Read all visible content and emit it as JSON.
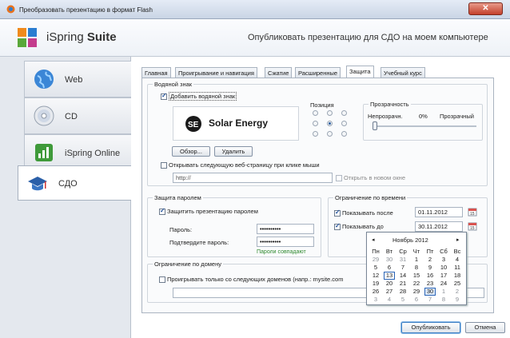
{
  "window": {
    "title": "Преобразовать презентацию в формат Flash",
    "close_icon": "close-icon"
  },
  "header": {
    "brand_name": "iSpring",
    "brand_product": "Suite",
    "subtitle": "Опубликовать презентацию для СДО на моем компьютере"
  },
  "sidebar": {
    "items": [
      {
        "label": "Web",
        "icon": "globe-icon"
      },
      {
        "label": "CD",
        "icon": "cd-icon"
      },
      {
        "label": "iSpring Online",
        "icon": "chart-icon"
      },
      {
        "label": "СДО",
        "icon": "graduation-cap-icon"
      }
    ]
  },
  "tabs": [
    "Главная",
    "Проигрывание и навигация",
    "Сжатие",
    "Расширенные",
    "Защита",
    "Учебный курс"
  ],
  "active_tab": "Защита",
  "watermark": {
    "group_label": "Водяной знак",
    "add_label": "Добавить водяной знак",
    "add_checked": true,
    "logo_mark": "SE",
    "logo_text": "Solar Energy",
    "position_label": "Позиция",
    "transparency_label": "Прозрачность",
    "opaque_label": "Непрозрачн.",
    "value_label": "0%",
    "transparent_label": "Прозрачный",
    "transparency_value": 0,
    "browse_button": "Обзор...",
    "delete_button": "Удалить",
    "open_page_label": "Открывать следующую веб-страницу при клике мыши",
    "open_page_checked": false,
    "url_value": "http://",
    "new_window_label": "Открыть в новом окне"
  },
  "password": {
    "group_label": "Защита паролем",
    "protect_label": "Защитить презентацию паролем",
    "protect_checked": true,
    "password_label": "Пароль:",
    "password_value": "••••••••••",
    "confirm_label": "Подтвердите пароль:",
    "confirm_value": "••••••••••",
    "match_text": "Пароли совпадают"
  },
  "time_limit": {
    "group_label": "Ограничение по времени",
    "show_after_label": "Показывать после",
    "show_after_value": "01.11.2012",
    "show_until_label": "Показывать до",
    "show_until_value": "30.11.2012"
  },
  "calendar": {
    "month": "Ноябрь 2012",
    "prev": "◂",
    "next": "▸",
    "weekdays": [
      "Пн",
      "Вт",
      "Ср",
      "Чт",
      "Пт",
      "Сб",
      "Вс"
    ],
    "weeks": [
      [
        "29",
        "30",
        "31",
        "1",
        "2",
        "3",
        "4"
      ],
      [
        "5",
        "6",
        "7",
        "8",
        "9",
        "10",
        "11"
      ],
      [
        "12",
        "13",
        "14",
        "15",
        "16",
        "17",
        "18"
      ],
      [
        "19",
        "20",
        "21",
        "22",
        "23",
        "24",
        "25"
      ],
      [
        "26",
        "27",
        "28",
        "29",
        "30",
        "1",
        "2"
      ],
      [
        "3",
        "4",
        "5",
        "6",
        "7",
        "8",
        "9"
      ]
    ],
    "today": "13",
    "selected": "30"
  },
  "domain": {
    "group_label": "Ограничение по домену",
    "restrict_label": "Проигрывать только со следующих доменов (напр.: mysite.com",
    "restrict_checked": false
  },
  "footer": {
    "publish_button": "Опубликовать",
    "cancel_button": "Отмена"
  }
}
